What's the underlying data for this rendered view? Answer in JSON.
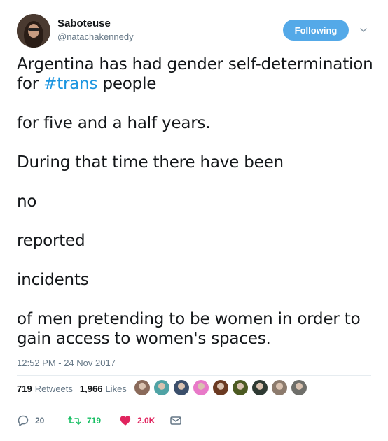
{
  "user": {
    "display_name": "Saboteuse",
    "handle": "@natachakennedy"
  },
  "follow_button": {
    "label": "Following",
    "color": "#54a9e8"
  },
  "tweet": {
    "line1_before": "Argentina has had gender self-determination\nfor ",
    "hashtag": "#trans",
    "line1_after": " people",
    "paragraphs": [
      "for five and a half years.",
      "During that time there have been",
      "no",
      "reported",
      "incidents",
      "of men pretending to be women in order to\ngain access to women's spaces."
    ],
    "timestamp": "12:52 PM - 24 Nov 2017",
    "hashtag_color": "#1b95e0"
  },
  "stats": {
    "retweets_count": "719",
    "retweets_label": "Retweets",
    "likes_count": "1,966",
    "likes_label": "Likes"
  },
  "likers": [
    {
      "icon": "avatar",
      "color": "#8a6a5a"
    },
    {
      "icon": "avatar",
      "color": "#4fa3a5"
    },
    {
      "icon": "avatar",
      "color": "#3b4f6b"
    },
    {
      "icon": "avatar",
      "color": "#e879c8"
    },
    {
      "icon": "avatar",
      "color": "#6b3a22"
    },
    {
      "icon": "avatar",
      "color": "#4c5a22"
    },
    {
      "icon": "avatar",
      "color": "#2e3a33"
    },
    {
      "icon": "avatar",
      "color": "#8c7b6d"
    },
    {
      "icon": "avatar",
      "color": "#6f6f6a"
    }
  ],
  "actions": {
    "reply_count": "20",
    "retweet_count": "719",
    "like_count": "2.0K",
    "reply_color": "#657786",
    "retweet_color": "#17bf63",
    "like_color": "#e0245e"
  }
}
